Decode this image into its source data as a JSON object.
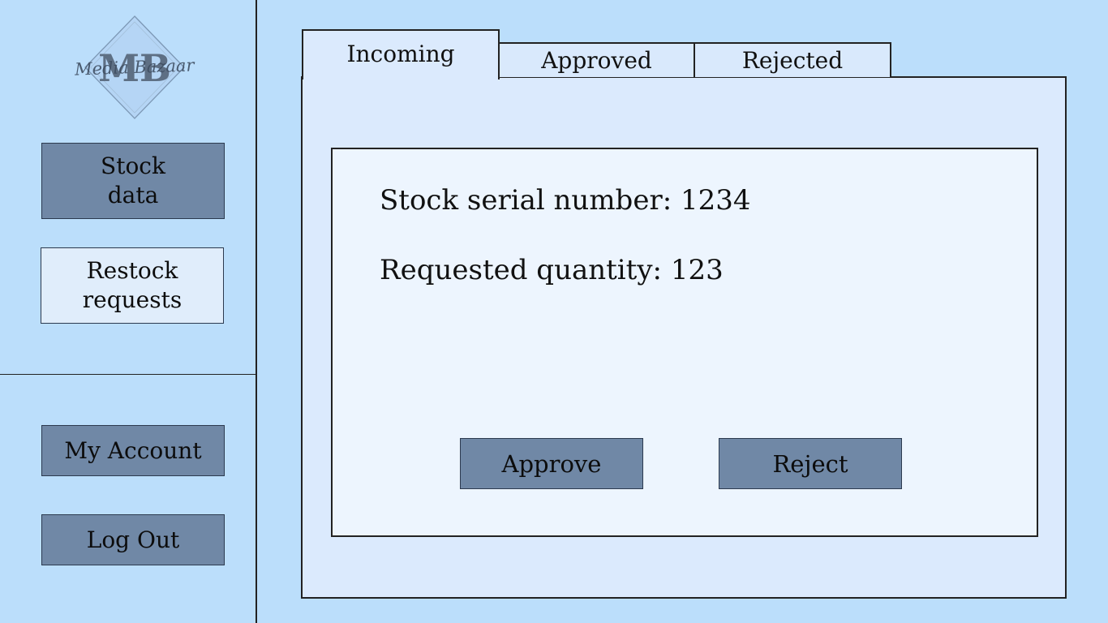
{
  "brand": {
    "logo_text": "Media Bazaar",
    "logo_initials": "MB"
  },
  "sidebar": {
    "stock_data": [
      "Stock",
      "data"
    ],
    "restock_requests": [
      "Restock",
      "requests"
    ],
    "my_account": "My Account",
    "log_out": "Log Out"
  },
  "tabs": [
    {
      "label": "Incoming",
      "active": true
    },
    {
      "label": "Approved",
      "active": false
    },
    {
      "label": "Rejected",
      "active": false
    }
  ],
  "request": {
    "serial_label": "Stock serial number: ",
    "serial_value": "1234",
    "quantity_label": "Requested quantity: ",
    "quantity_value": "123"
  },
  "actions": {
    "approve_label": "Approve",
    "reject_label": "Reject"
  },
  "colors": {
    "background": "#bbdefb",
    "button": "#7088a6",
    "active_button": "#e0edfb",
    "panel": "#dbeafd",
    "card": "#edf5fe"
  }
}
